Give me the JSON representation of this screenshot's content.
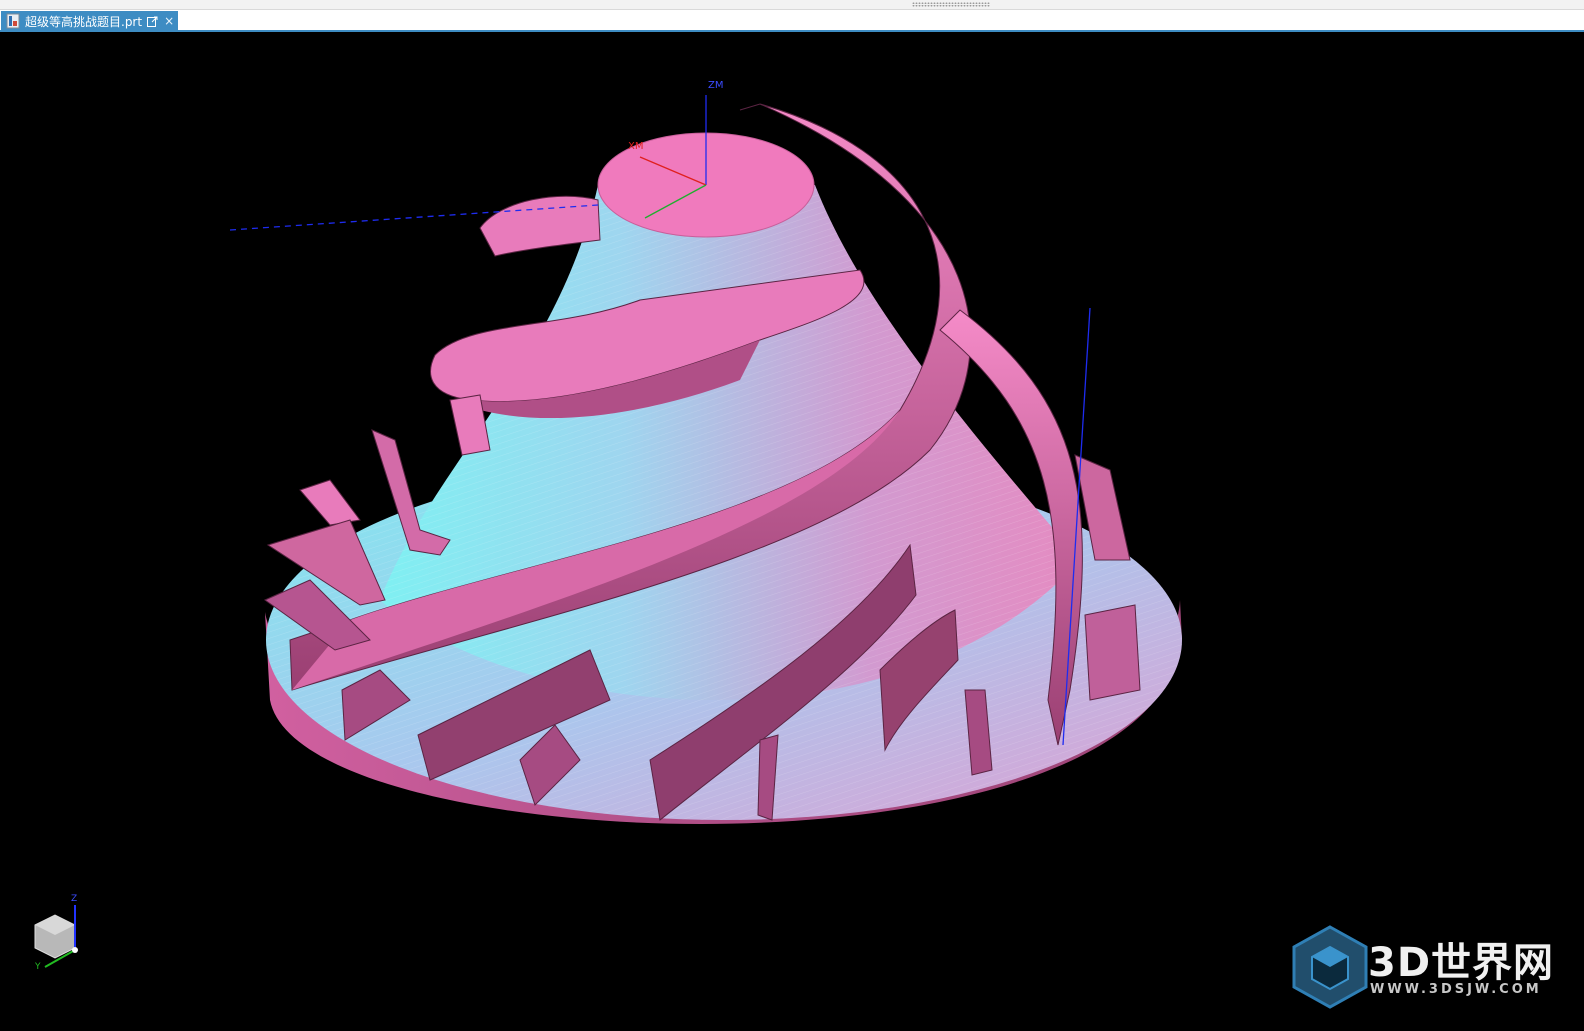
{
  "window": {
    "tab": {
      "label": "超级等高挑战题目.prt",
      "icon": "nx-part-icon",
      "popout_icon": "popout-icon",
      "close_glyph": "×"
    }
  },
  "viewport": {
    "background": "#000000",
    "model_color": "#e77bb8",
    "toolpath_color": "#29e9ea",
    "wcs": {
      "z_label": "ZM",
      "x_label": "XM"
    },
    "view_triad": {
      "z_label": "Z",
      "y_label": "Y"
    }
  },
  "watermark": {
    "title": "3D世界网",
    "url": "WWW.3DSJW.COM",
    "logo": "cube-logo-icon"
  }
}
